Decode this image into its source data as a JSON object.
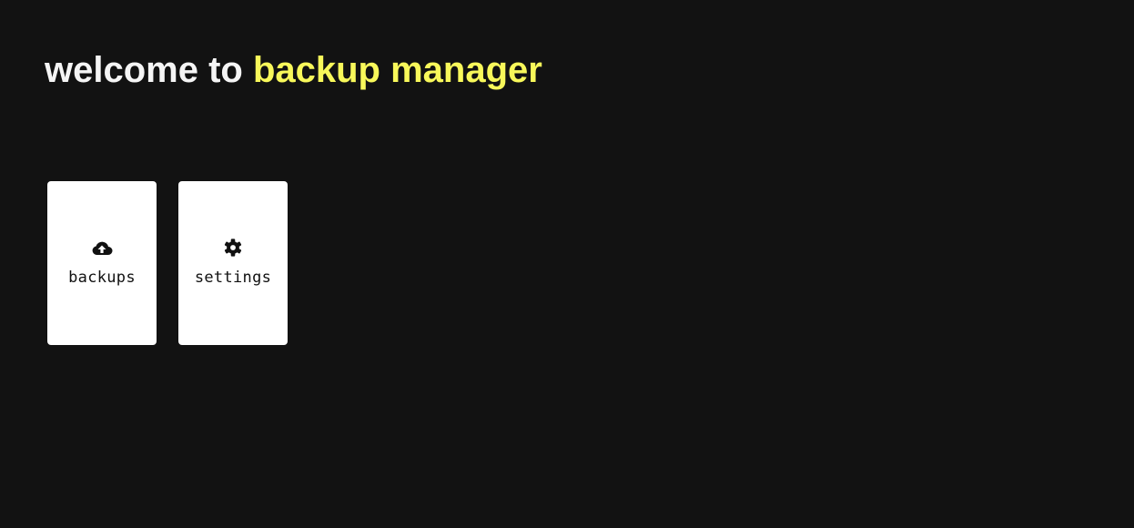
{
  "header": {
    "title_prefix": "welcome to ",
    "title_accent": "backup manager"
  },
  "colors": {
    "background": "#121212",
    "title_text": "#f5f5f5",
    "accent": "#f8f85a",
    "card": "#ffffff",
    "card_text": "#111111"
  },
  "cards": [
    {
      "label": "backups",
      "icon": "cloud-upload-icon"
    },
    {
      "label": "settings",
      "icon": "gear-icon"
    }
  ]
}
